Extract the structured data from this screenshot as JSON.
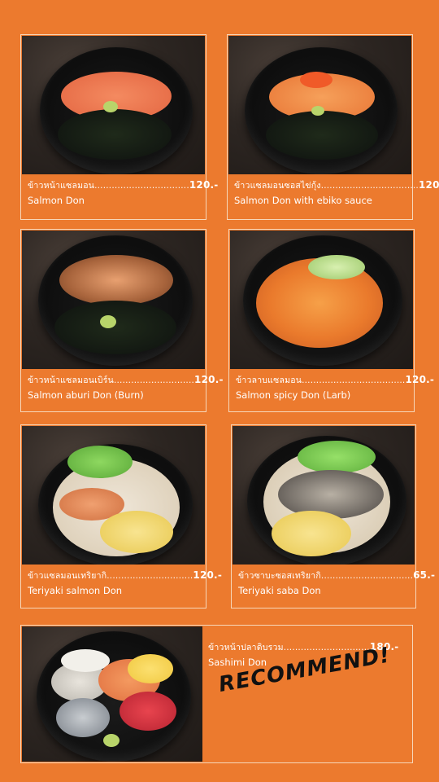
{
  "menu": [
    {
      "thai": "ข้าวหน้าแซลมอน",
      "price": "120.-",
      "name": "Salmon Don",
      "dots": ".................................",
      "topping": "salmon"
    },
    {
      "thai": "ข้าวแซลมอนซอสไข่กุ้ง",
      "price": "120.-",
      "name": "Salmon Don with ebiko sauce",
      "dots": "..................................",
      "topping": "ebiko"
    },
    {
      "thai": "ข้าวหน้าแซลมอนเบิร์น",
      "price": "120.-",
      "name": "Salmon aburi Don (Burn)",
      "dots": "............................",
      "topping": "aburi"
    },
    {
      "thai": "ข้าวลาบแซลมอน",
      "price": "120.-",
      "name": "Salmon spicy Don (Larb)",
      "dots": "....................................",
      "topping": "larb"
    },
    {
      "thai": "ข้าวแซลมอนเทริยากิ",
      "price": "120.-",
      "name": "Teriyaki salmon Don",
      "dots": "..............................",
      "topping": "teriyaki"
    },
    {
      "thai": "ข้าวซาบะซอสเทริยากิ",
      "price": "65.-",
      "name": "Teriyaki saba Don",
      "dots": "................................",
      "topping": "saba"
    },
    {
      "thai": "ข้าวหน้าปลาดิบรวม",
      "price": "180.-",
      "name": "Sashimi Don",
      "dots": "..............................",
      "topping": "sashimi"
    }
  ],
  "recommend_label": "RECOMMEND!",
  "colors": {
    "background": "#ec7a2e",
    "border": "#f7d7b9",
    "text": "#ffffff"
  }
}
